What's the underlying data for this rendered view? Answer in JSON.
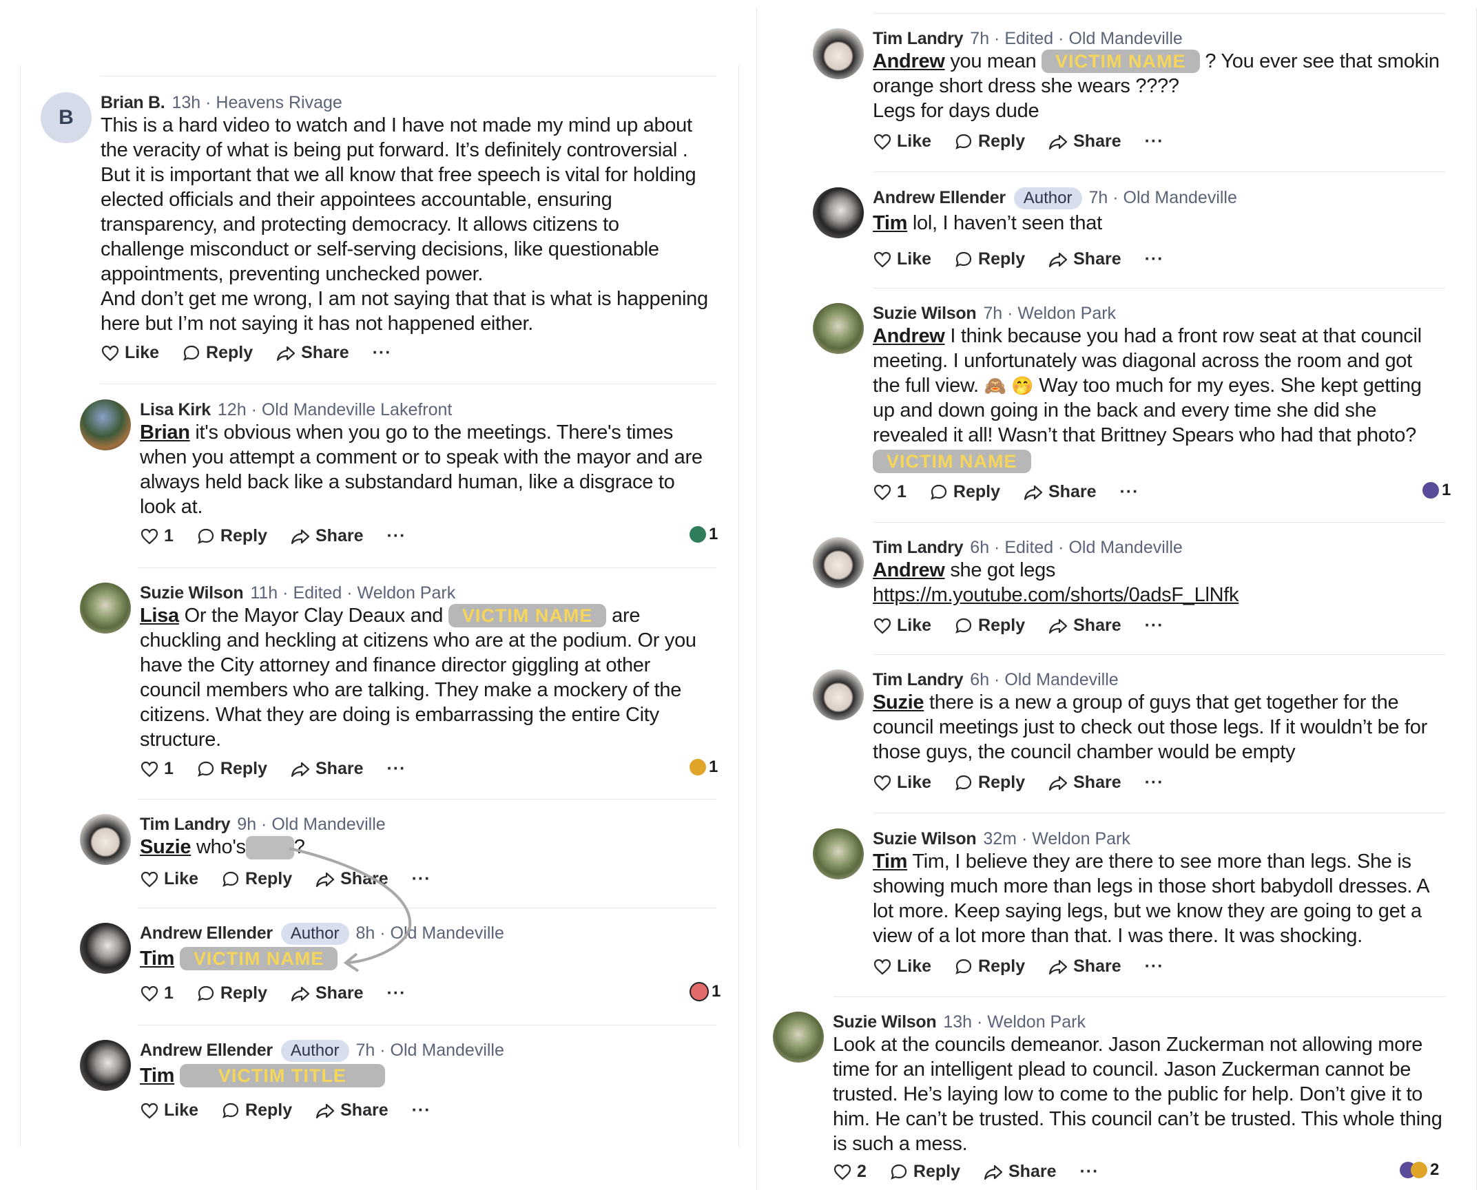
{
  "left_comments": [
    {
      "name": "Brian B.",
      "time": "13h",
      "location": "Heavens Rivage",
      "avatar_letter": "B",
      "text": [
        "This is a hard video to watch and I have not made my mind up about",
        "the veracity of what is being put forward. It’s definitely controversial .",
        "But it is important that we all know that free speech is vital for holding",
        "elected officials and their appointees accountable, ensuring",
        "transparency, and protecting democracy. It allows citizens to",
        "challenge misconduct or self-serving decisions, like questionable",
        "appointments, preventing unchecked power.",
        "And don’t get me wrong, I am not saying that that is what is happening",
        "here but I’m not saying it has not happened either."
      ],
      "like": "Like",
      "reply": "Reply",
      "share": "Share"
    },
    {
      "name": "Lisa Kirk",
      "time": "12h",
      "location": "Old Mandeville Lakefront",
      "mention": "Brian",
      "text": [
        "it's obvious when you go to the meetings. There's times",
        "when you attempt a comment or to speak with the  mayor and are",
        "always  held back like a substandard human, like a disgrace to",
        "look at."
      ],
      "likes": "1",
      "reply": "Reply",
      "share": "Share",
      "reaction_count": "1"
    },
    {
      "name": "Suzie Wilson",
      "time": "11h",
      "edited": "Edited",
      "location": "Weldon Park",
      "mention": "Lisa",
      "text_a": "Or the Mayor Clay Deaux and",
      "redaction": "VICTIM NAME",
      "text_b": "are",
      "text": [
        "chuckling and heckling at citizens who are at the podium. Or you",
        "have the City attorney and finance director giggling at other",
        "council members who are talking. They make a mockery of the",
        "citizens. What they are doing is embarrassing the entire City",
        "structure."
      ],
      "likes": "1",
      "reply": "Reply",
      "share": "Share",
      "reaction_count": "1"
    },
    {
      "name": "Tim Landry",
      "time": "9h",
      "location": "Old Mandeville",
      "mention": "Suzie",
      "text_a": "who's",
      "text_b": "?",
      "like": "Like",
      "reply": "Reply",
      "share": "Share"
    },
    {
      "name": "Andrew Ellender",
      "badge": "Author",
      "time": "8h",
      "location": "Old Mandeville",
      "mention": "Tim",
      "redaction": "VICTIM NAME",
      "likes": "1",
      "reply": "Reply",
      "share": "Share",
      "reaction_count": "1"
    },
    {
      "name": "Andrew Ellender",
      "badge": "Author",
      "time": "7h",
      "location": "Old Mandeville",
      "mention": "Tim",
      "redaction": "VICTIM TITLE",
      "like": "Like",
      "reply": "Reply",
      "share": "Share"
    }
  ],
  "right_comments": [
    {
      "name": "Tim Landry",
      "time": "7h",
      "edited": "Edited",
      "location": "Old Mandeville",
      "mention": "Andrew",
      "text_a": "you mean",
      "redaction": "VICTIM NAME",
      "text_b": "?   You ever see that smokin",
      "text": [
        "orange short dress she wears ????",
        "Legs for days dude"
      ],
      "like": "Like",
      "reply": "Reply",
      "share": "Share"
    },
    {
      "name": "Andrew Ellender",
      "badge": "Author",
      "time": "7h",
      "location": "Old Mandeville",
      "mention": "Tim",
      "text_a": "lol, I haven’t seen that",
      "like": "Like",
      "reply": "Reply",
      "share": "Share"
    },
    {
      "name": "Suzie Wilson",
      "time": "7h",
      "location": "Weldon Park",
      "mention": "Andrew",
      "text_a": "I think because you had a front row seat at that council",
      "text": [
        "meeting. I unfortunately was diagonal across the room and got"
      ],
      "text_c": "the full view.",
      "emoji_1": "🙈",
      "emoji_2": "🤭",
      "text_d": "Way too much for my eyes.  She kept getting",
      "text2": [
        "up and down going in the back and every time she did she",
        "revealed it all! Wasn’t that Brittney Spears who had that photo?"
      ],
      "redaction": "VICTIM NAME",
      "likes": "1",
      "reply": "Reply",
      "share": "Share",
      "reaction_count": "1"
    },
    {
      "name": "Tim Landry",
      "time": "6h",
      "edited": "Edited",
      "location": "Old Mandeville",
      "mention": "Andrew",
      "text_a": "she got legs",
      "link": "https://m.youtube.com/shorts/0adsF_LlNfk",
      "like": "Like",
      "reply": "Reply",
      "share": "Share"
    },
    {
      "name": "Tim Landry",
      "time": "6h",
      "location": "Old Mandeville",
      "mention": "Suzie",
      "text_a": "there is a new a group of guys that get together for the",
      "text": [
        "council meetings just to check out those legs.  If it wouldn’t be for",
        "those guys, the council chamber would be empty"
      ],
      "like": "Like",
      "reply": "Reply",
      "share": "Share"
    },
    {
      "name": "Suzie Wilson",
      "time": "32m",
      "location": "Weldon Park",
      "mention": "Tim",
      "text_a": "Tim, I believe they are there to see more than legs. She is",
      "text": [
        "showing much more than legs in those short babydoll dresses. A",
        "lot more. Keep saying legs, but we know they are going to get a",
        "view of a lot more than that. I was there. It was shocking."
      ],
      "like": "Like",
      "reply": "Reply",
      "share": "Share"
    },
    {
      "name": "Suzie Wilson",
      "time": "13h",
      "location": "Weldon Park",
      "text": [
        "Look at the councils demeanor. Jason Zuckerman not allowing more",
        "time for an intelligent plead to council. Jason Zuckerman cannot be",
        "trusted. He’s laying low to come to the public for help. Don’t give it to",
        "him. He can’t be trusted. This council can’t be trusted. This whole thing",
        "is such a mess."
      ],
      "likes": "2",
      "reply": "Reply",
      "share": "Share",
      "reaction_count": "2"
    }
  ],
  "more_label": "···",
  "colors": {
    "meta": "#5a6378",
    "badge": "#d7deee",
    "redaction_bg": "#b7b7b7",
    "redaction_text": "#f5d65a"
  }
}
